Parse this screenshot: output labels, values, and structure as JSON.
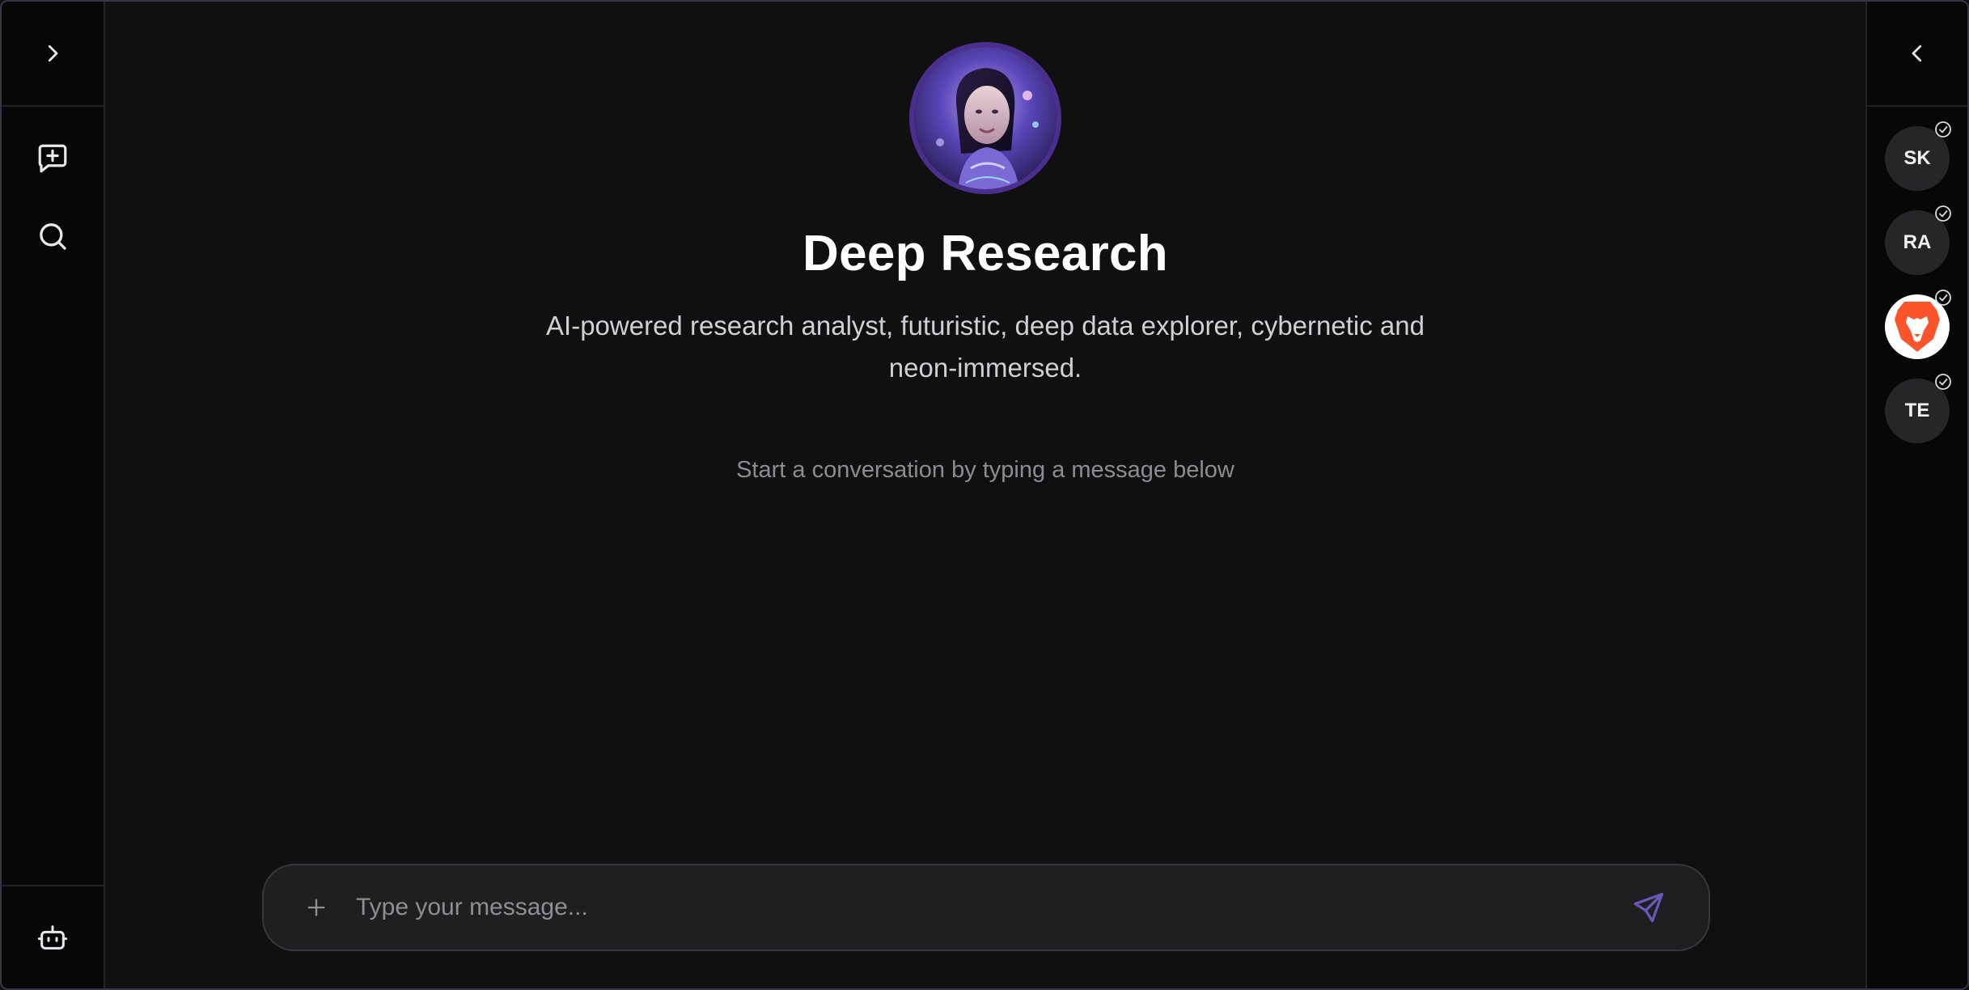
{
  "app": {
    "accent_color": "#4a2f8f"
  },
  "left_rail": {
    "expand_icon": "chevron-right-icon",
    "new_chat_icon": "message-plus-icon",
    "search_icon": "search-icon",
    "agent_icon": "robot-icon"
  },
  "right_rail": {
    "collapse_icon": "chevron-left-icon",
    "agents": [
      {
        "initials": "SK",
        "selected": true
      },
      {
        "initials": "RA",
        "selected": true
      },
      {
        "initials": "",
        "icon": "brave-lion-icon",
        "selected": true
      },
      {
        "initials": "TE",
        "selected": true
      }
    ]
  },
  "hero": {
    "title": "Deep Research",
    "description": "AI-powered research analyst, futuristic, deep data explorer, cybernetic and neon-immersed.",
    "hint": "Start a conversation by typing a message below"
  },
  "composer": {
    "placeholder": "Type your message...",
    "value": "",
    "attach_icon": "plus-icon",
    "send_icon": "send-icon"
  }
}
